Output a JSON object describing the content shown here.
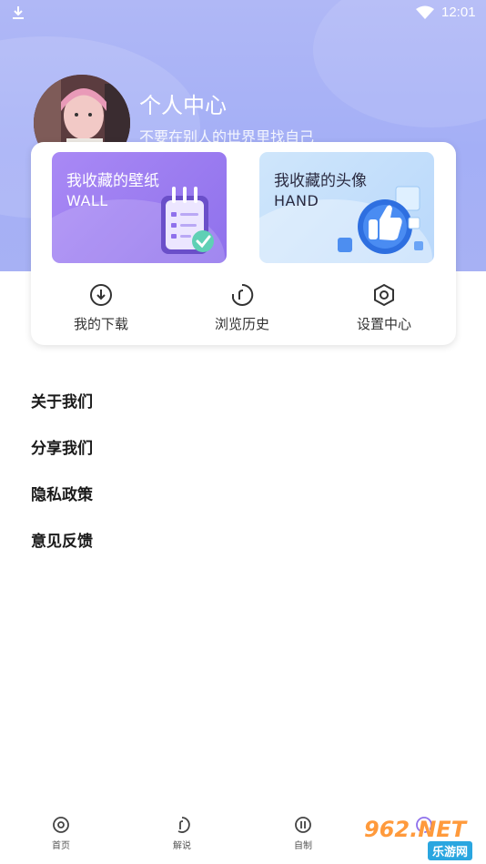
{
  "status_bar": {
    "time": "12:01",
    "download_icon": "download-icon",
    "wifi_icon": "wifi-icon"
  },
  "profile": {
    "title": "个人中心",
    "subtitle": "不要在别人的世界里找自己"
  },
  "favorites": [
    {
      "title": "我收藏的壁纸",
      "subtitle": "WALL",
      "color": "#9a7cf2"
    },
    {
      "title": "我收藏的头像",
      "subtitle": "HAND",
      "color": "#c4dffb"
    }
  ],
  "quick_actions": [
    {
      "label": "我的下载",
      "icon": "download-circle-icon"
    },
    {
      "label": "浏览历史",
      "icon": "history-icon"
    },
    {
      "label": "设置中心",
      "icon": "settings-icon"
    }
  ],
  "menu": [
    {
      "label": "关于我们"
    },
    {
      "label": "分享我们"
    },
    {
      "label": "隐私政策"
    },
    {
      "label": "意见反馈"
    }
  ],
  "tabbar": [
    {
      "label": "首页",
      "icon": "home-icon"
    },
    {
      "label": "解说",
      "icon": "commentary-icon"
    },
    {
      "label": "自制",
      "icon": "create-icon"
    },
    {
      "label": "",
      "icon": "profile-icon"
    }
  ],
  "watermark": {
    "top": "962.NET",
    "bottom": "乐游网"
  },
  "colors": {
    "accent": "#a6b0f5",
    "purple_tile": "#9a7cf2",
    "blue_tile": "#c4dffb"
  }
}
